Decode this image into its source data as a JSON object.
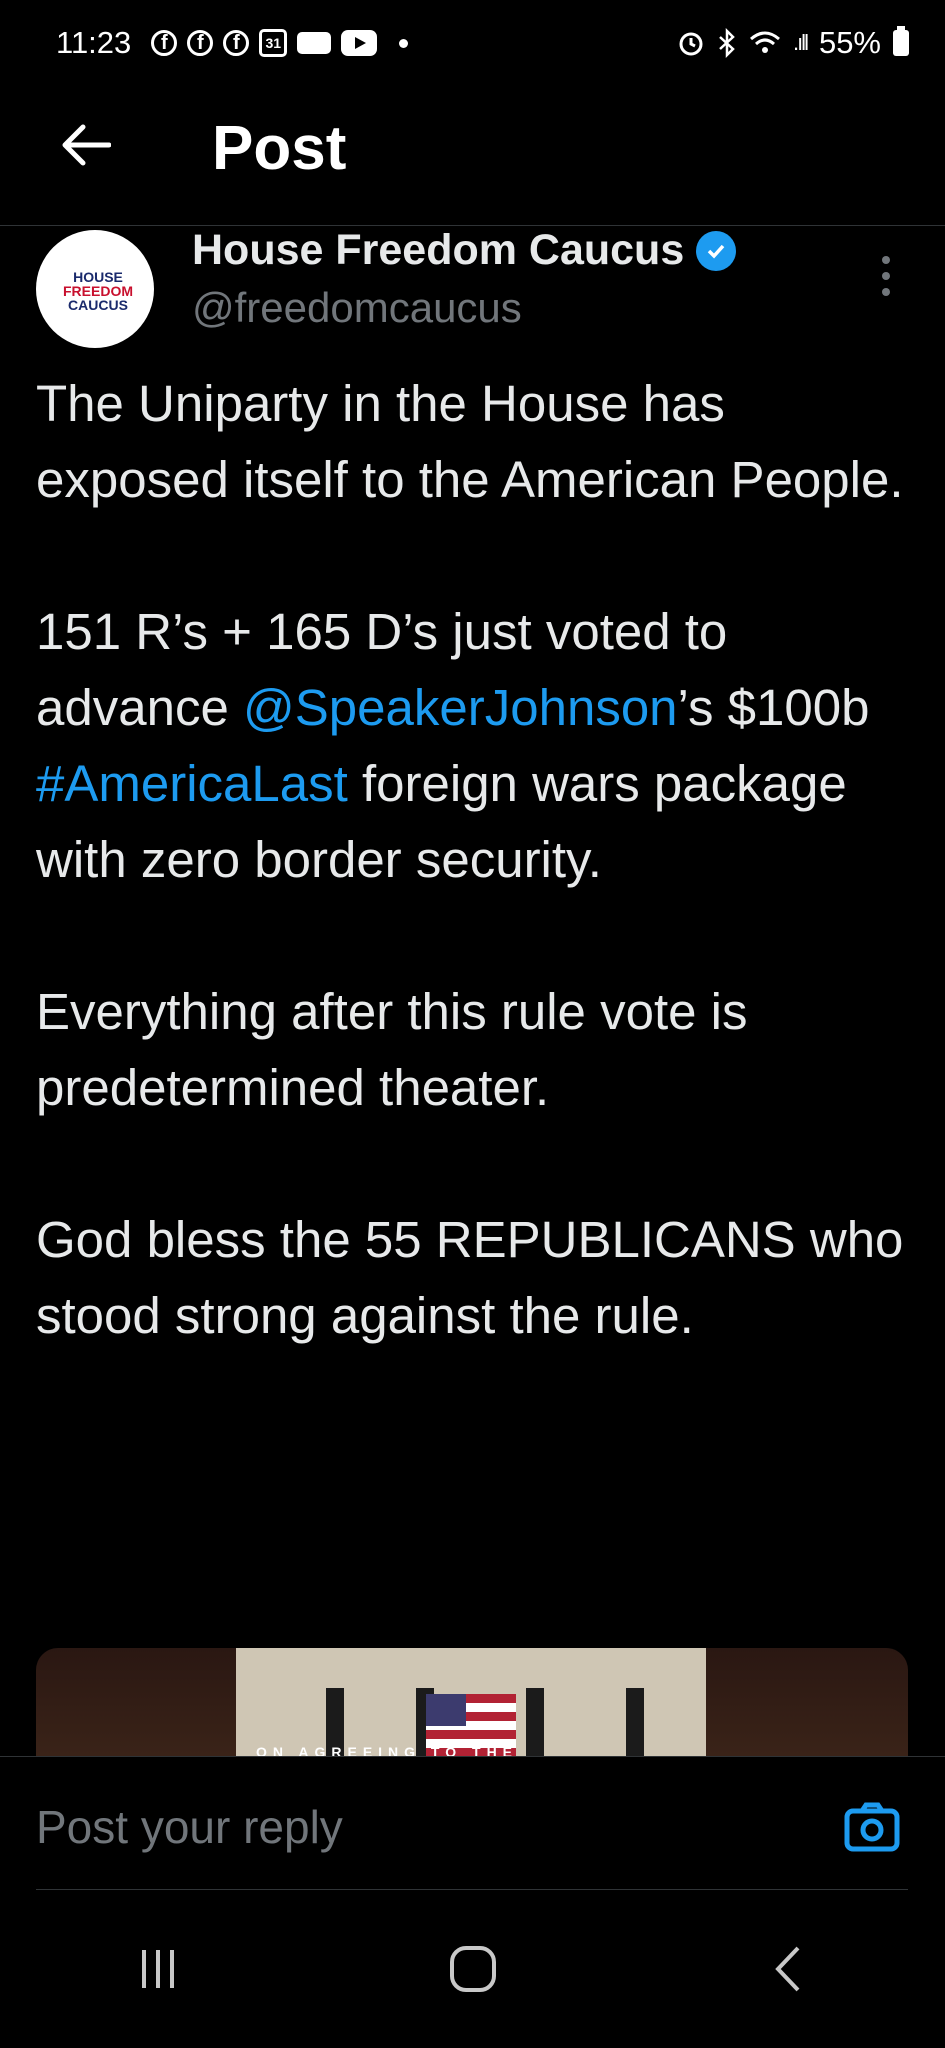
{
  "status_bar": {
    "time": "11:23",
    "calendar_day": "31",
    "battery": "55%"
  },
  "header": {
    "title": "Post"
  },
  "post": {
    "author_name": "House Freedom Caucus",
    "author_handle": "@freedomcaucus",
    "avatar_text": {
      "line1": "HOUSE",
      "line2": "FREEDOM",
      "line3": "CAUCUS"
    },
    "paragraph1": "The Uniparty in the House has exposed itself to the American People.",
    "paragraph2_part1": "151 R’s + 165 D’s just voted to advance ",
    "mention": "@SpeakerJohnson",
    "paragraph2_part2": "’s $100b ",
    "hashtag": "#AmericaLast",
    "paragraph2_part3": " foreign wars package with zero border security.",
    "paragraph3": "Everything after this rule vote is predetermined theater.",
    "paragraph4": "God bless the 55 REPUBLICANS who stood strong against the rule.",
    "media_caption": "ON AGREEING TO THE"
  },
  "reply": {
    "placeholder": "Post your reply"
  },
  "colors": {
    "background": "#000000",
    "text": "#e7e9ea",
    "muted": "#71767b",
    "accent": "#1d9bf0"
  },
  "icons": {
    "back": "arrow-left-icon",
    "verified": "verified-badge-icon",
    "more": "more-vertical-icon",
    "camera": "camera-icon",
    "nav_recent": "recent-apps-icon",
    "nav_home": "home-icon",
    "nav_back": "nav-back-icon"
  }
}
